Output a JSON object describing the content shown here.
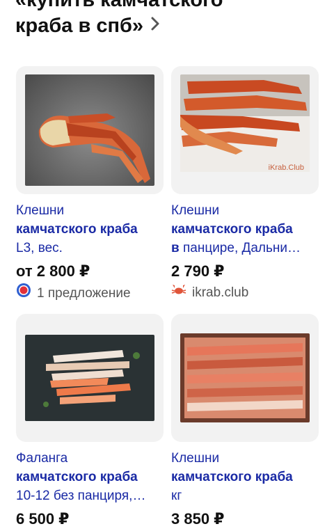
{
  "header": {
    "line1": "купить камчатского",
    "line2": "краба в спб»",
    "open_quote": "«"
  },
  "cards": [
    {
      "title1": "Клешни",
      "title2_bold": "камчатского краба",
      "title2_rest": "",
      "title3": "L3, вес.",
      "price": "от 2 800 ₽",
      "shop": "1 предложение",
      "shop_icon": "offers-badge-icon",
      "image": "crab-claws-on-stone-photo"
    },
    {
      "title1": "Клешни",
      "title2_bold": "камчатского краба",
      "title2_rest": "",
      "title3_bold": "в",
      "title3_rest": " панцире, Дальни…",
      "price": "2 790 ₽",
      "shop": "ikrab.club",
      "shop_icon": "crab-icon",
      "image": "crab-legs-on-board-photo",
      "watermark": "iKrab.Club"
    },
    {
      "title1": "Фаланга",
      "title2_bold": "камчатского краба",
      "title3": "10-12 без панциря,…",
      "price": "6 500 ₽",
      "image": "peeled-crab-phalanges-photo"
    },
    {
      "title1": "Клешни",
      "title2_bold": "камчатского краба",
      "title3": "кг",
      "price": "3 850 ₽",
      "image": "frozen-crab-legs-box-photo"
    }
  ]
}
